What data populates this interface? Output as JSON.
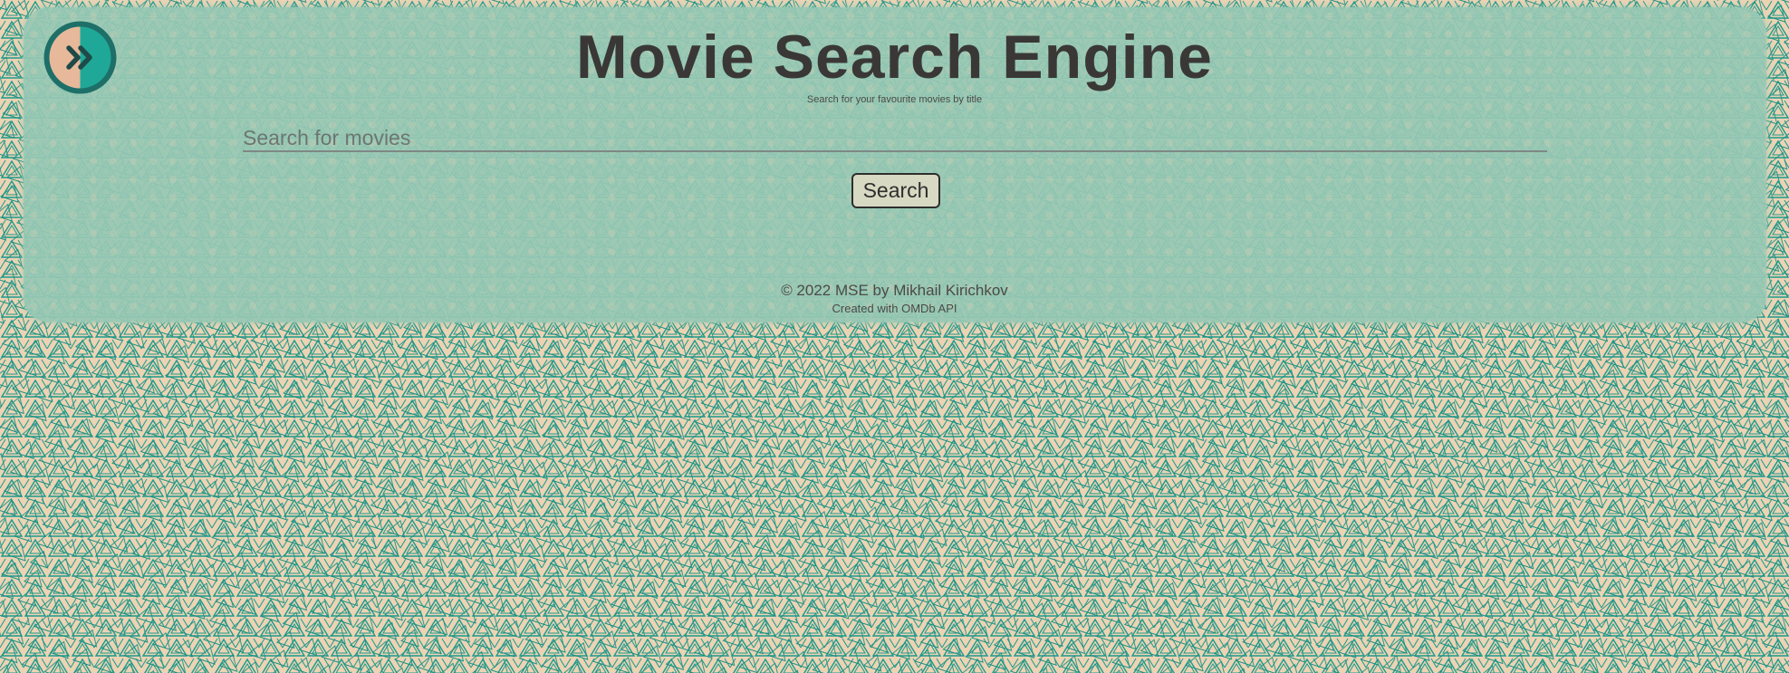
{
  "header": {
    "title": "Movie Search Engine",
    "subtitle": "Search for your favourite movies by title",
    "logo_icon": "double-chevron-right-icon"
  },
  "search": {
    "placeholder": "Search for movies",
    "value": "",
    "button_label": "Search"
  },
  "footer": {
    "copyright": "© 2022 MSE by Mikhail Kirichkov",
    "credit": "Created with OMDb API"
  },
  "colors": {
    "background": "#ecd3b4",
    "pattern": "#1a9a8c",
    "panel": "#96c8b4",
    "title_text": "#3a3837",
    "button_bg": "#d8d9c3",
    "logo_left": "#e8b89a",
    "logo_right": "#1fa898"
  }
}
